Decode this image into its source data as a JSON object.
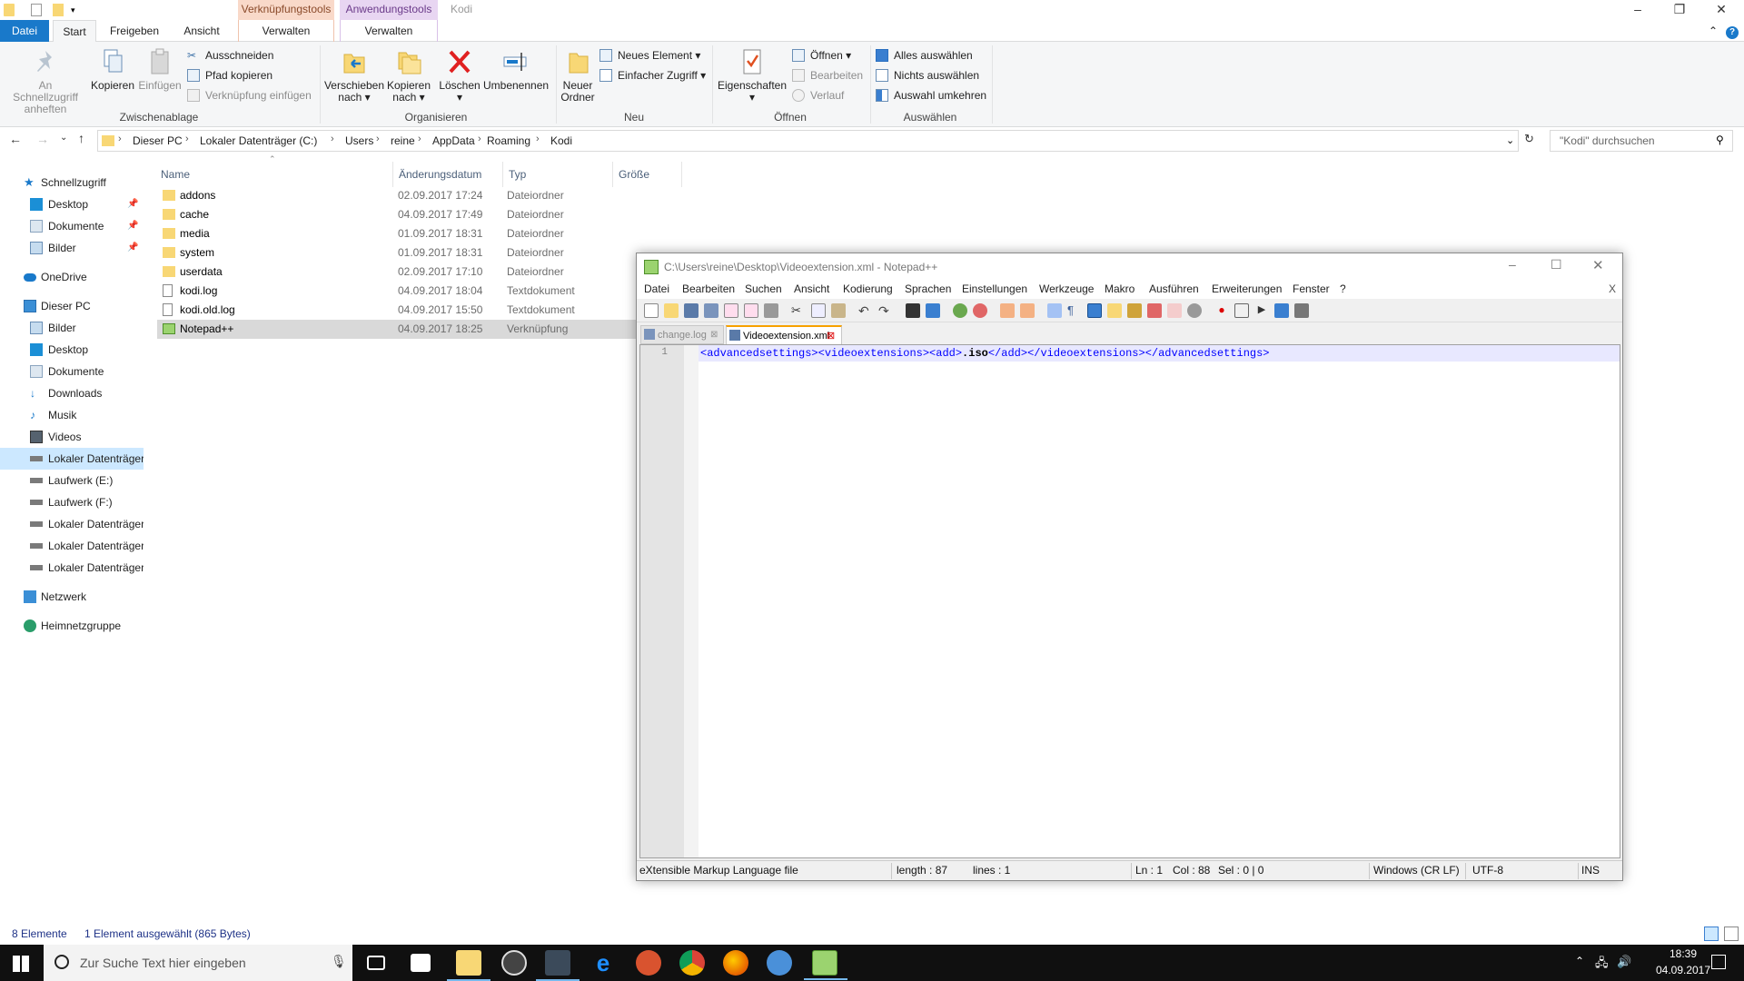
{
  "explorer": {
    "context_tabs": [
      {
        "label": "Verknüpfungstools",
        "sub": "Verwalten",
        "color": "#f9d9c9"
      },
      {
        "label": "Anwendungstools",
        "sub": "Verwalten",
        "color": "#e8d6f2"
      }
    ],
    "window_title": "Kodi",
    "ribbon_tabs": [
      "Datei",
      "Start",
      "Freigeben",
      "Ansicht"
    ],
    "groups": {
      "zwischenablage": {
        "label": "Zwischenablage",
        "pin": "An Schnellzugriff anheften",
        "pin_l1": "An Schnellzugriff",
        "pin_l2": "anheften",
        "copy": "Kopieren",
        "paste": "Einfügen",
        "cut": "Ausschneiden",
        "copy_path": "Pfad kopieren",
        "paste_link": "Verknüpfung einfügen"
      },
      "organisieren": {
        "label": "Organisieren",
        "move_l1": "Verschieben",
        "move_l2": "nach",
        "copyto_l1": "Kopieren",
        "copyto_l2": "nach",
        "delete": "Löschen",
        "rename": "Umbenennen"
      },
      "neu": {
        "label": "Neu",
        "new_folder_l1": "Neuer",
        "new_folder_l2": "Ordner",
        "new_item": "Neues Element",
        "easy_access": "Einfacher Zugriff"
      },
      "oeffnen": {
        "label": "Öffnen",
        "properties": "Eigenschaften",
        "open": "Öffnen",
        "edit": "Bearbeiten",
        "history": "Verlauf"
      },
      "auswaehlen": {
        "label": "Auswählen",
        "select_all": "Alles auswählen",
        "select_none": "Nichts auswählen",
        "invert": "Auswahl umkehren"
      }
    },
    "breadcrumb": [
      "Dieser PC",
      "Lokaler Datenträger (C:)",
      "Users",
      "reine",
      "AppData",
      "Roaming",
      "Kodi"
    ],
    "search_placeholder": "\"Kodi\" durchsuchen",
    "nav": {
      "quick": "Schnellzugriff",
      "quick_items": [
        "Desktop",
        "Dokumente",
        "Bilder"
      ],
      "onedrive": "OneDrive",
      "thispc": "Dieser PC",
      "pc_items": [
        "Bilder",
        "Desktop",
        "Dokumente",
        "Downloads",
        "Musik",
        "Videos",
        "Lokaler Datenträger",
        "Laufwerk (E:)",
        "Laufwerk (F:)",
        "Lokaler Datenträger",
        "Lokaler Datenträger",
        "Lokaler Datenträger"
      ],
      "network": "Netzwerk",
      "homegroup": "Heimnetzgruppe"
    },
    "columns": [
      "Name",
      "Änderungsdatum",
      "Typ",
      "Größe"
    ],
    "files": [
      {
        "name": "addons",
        "date": "02.09.2017 17:24",
        "type": "Dateiordner",
        "size": ""
      },
      {
        "name": "cache",
        "date": "04.09.2017 17:49",
        "type": "Dateiordner",
        "size": ""
      },
      {
        "name": "media",
        "date": "01.09.2017 18:31",
        "type": "Dateiordner",
        "size": ""
      },
      {
        "name": "system",
        "date": "01.09.2017 18:31",
        "type": "Dateiordner",
        "size": ""
      },
      {
        "name": "userdata",
        "date": "02.09.2017 17:10",
        "type": "Dateiordner",
        "size": ""
      },
      {
        "name": "kodi.log",
        "date": "04.09.2017 18:04",
        "type": "Textdokument",
        "size": ""
      },
      {
        "name": "kodi.old.log",
        "date": "04.09.2017 15:50",
        "type": "Textdokument",
        "size": ""
      },
      {
        "name": "Notepad++",
        "date": "04.09.2017 18:25",
        "type": "Verknüpfung",
        "size": ""
      }
    ],
    "status_count": "8 Elemente",
    "status_selected": "1 Element ausgewählt (865 Bytes)"
  },
  "notepad": {
    "title": "C:\\Users\\reine\\Desktop\\Videoextension.xml - Notepad++",
    "menu": [
      "Datei",
      "Bearbeiten",
      "Suchen",
      "Ansicht",
      "Kodierung",
      "Sprachen",
      "Einstellungen",
      "Werkzeuge",
      "Makro",
      "Ausführen",
      "Erweiterungen",
      "Fenster",
      "?"
    ],
    "menu_close": "X",
    "tabs": [
      {
        "label": "change.log",
        "active": false
      },
      {
        "label": "Videoextension.xml",
        "active": true
      }
    ],
    "line_number": "1",
    "code_pre": "<advancedsettings><videoextensions><add>",
    "code_mid": ".iso",
    "code_post": "</add></videoextensions></advancedsettings>",
    "status": {
      "filetype": "eXtensible Markup Language file",
      "length": "length : 87",
      "lines": "lines : 1",
      "ln": "Ln : 1",
      "col": "Col : 88",
      "sel": "Sel : 0 | 0",
      "eol": "Windows (CR LF)",
      "encoding": "UTF-8",
      "mode": "INS"
    }
  },
  "taskbar": {
    "search_placeholder": "Zur Suche Text hier eingeben",
    "time": "18:39",
    "date": "04.09.2017"
  }
}
